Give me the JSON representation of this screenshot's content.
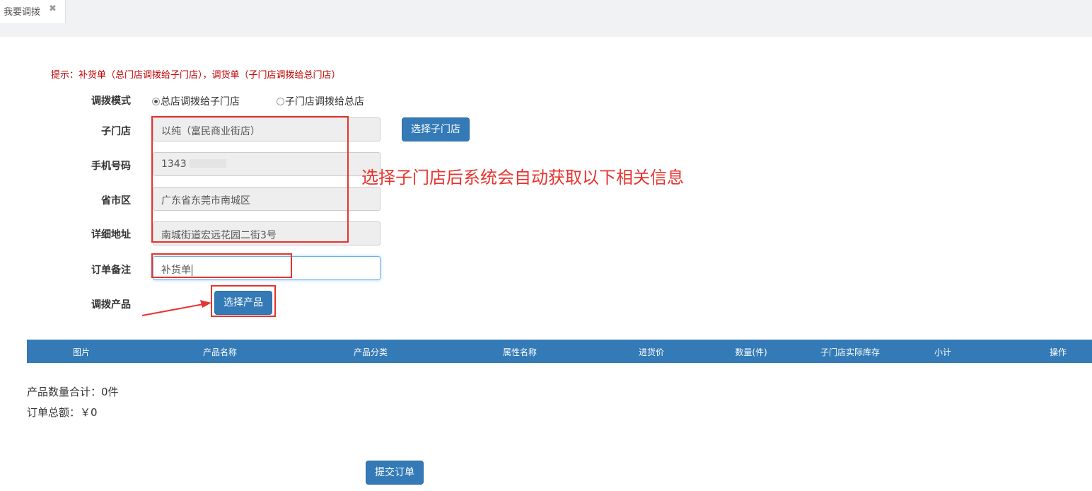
{
  "tab": {
    "title": "我要调拨",
    "close_icon": "close-icon"
  },
  "hint": "提示：补货单（总门店调拨给子门店），调货单（子门店调拨给总门店）",
  "form": {
    "mode_label": "调拨模式",
    "mode_options": [
      {
        "label": "总店调拨给子门店",
        "selected": true
      },
      {
        "label": "子门店调拨给总店",
        "selected": false
      }
    ],
    "substore_label": "子门店",
    "substore_value": "以纯（富民商业街店）",
    "select_substore_button": "选择子门店",
    "phone_label": "手机号码",
    "phone_value": "1343",
    "region_label": "省市区",
    "region_value": "广东省东莞市南城区",
    "address_label": "详细地址",
    "address_value": "南城街道宏远花园二街3号",
    "remark_label": "订单备注",
    "remark_value": "补货单",
    "product_label": "调拨产品",
    "select_product_button": "选择产品"
  },
  "annotation": "选择子门店后系统会自动获取以下相关信息",
  "table": {
    "columns": [
      "图片",
      "产品名称",
      "产品分类",
      "属性名称",
      "进货价",
      "数量(件)",
      "子门店实际库存",
      "小计",
      "操作"
    ]
  },
  "summary": {
    "quantity_total": "产品数量合计：0件",
    "order_total": "订单总额：￥0"
  },
  "submit_button": "提交订单",
  "colors": {
    "primary": "#337ab7",
    "hint": "#c00000",
    "annotation": "#e8332e"
  }
}
